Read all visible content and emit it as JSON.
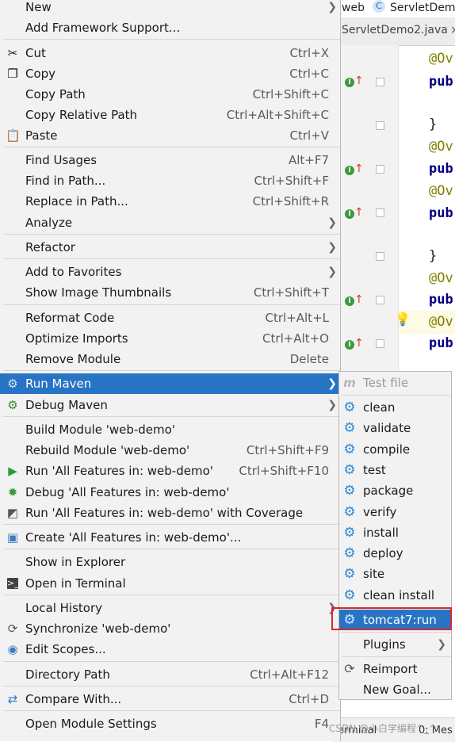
{
  "editor": {
    "tabs": [
      "web",
      "C",
      "ServletDem"
    ],
    "active_file": "ServletDemo2.java",
    "code_lines": [
      {
        "text": "@Ov",
        "kind": "anno"
      },
      {
        "text": "pub",
        "kind": "kw"
      },
      {
        "text": "}",
        "kind": "plain"
      },
      {
        "text": "@Ov",
        "kind": "anno"
      },
      {
        "text": "pub",
        "kind": "kw"
      },
      {
        "text": "@Ov",
        "kind": "anno"
      },
      {
        "text": "pub",
        "kind": "kw"
      },
      {
        "text": "}",
        "kind": "plain"
      },
      {
        "text": "@Ov",
        "kind": "anno"
      },
      {
        "text": "pub",
        "kind": "kw"
      },
      {
        "text": "@Ov",
        "kind": "anno"
      },
      {
        "text": "pub",
        "kind": "kw"
      }
    ],
    "bottom_bar": {
      "terminal": "erminal",
      "messages": "0: Mes"
    }
  },
  "menu": {
    "items": [
      {
        "label": "New",
        "submenu": true
      },
      {
        "label": "Add Framework Support..."
      },
      {
        "label": "Cut",
        "shortcut": "Ctrl+X",
        "icon": "scissors-icon"
      },
      {
        "label": "Copy",
        "shortcut": "Ctrl+C",
        "icon": "copy-icon"
      },
      {
        "label": "Copy Path",
        "shortcut": "Ctrl+Shift+C"
      },
      {
        "label": "Copy Relative Path",
        "shortcut": "Ctrl+Alt+Shift+C"
      },
      {
        "label": "Paste",
        "shortcut": "Ctrl+V",
        "icon": "clipboard-icon"
      },
      {
        "label": "Find Usages",
        "shortcut": "Alt+F7"
      },
      {
        "label": "Find in Path...",
        "shortcut": "Ctrl+Shift+F"
      },
      {
        "label": "Replace in Path...",
        "shortcut": "Ctrl+Shift+R"
      },
      {
        "label": "Analyze",
        "submenu": true
      },
      {
        "label": "Refactor",
        "submenu": true
      },
      {
        "label": "Add to Favorites",
        "submenu": true
      },
      {
        "label": "Show Image Thumbnails",
        "shortcut": "Ctrl+Shift+T"
      },
      {
        "label": "Reformat Code",
        "shortcut": "Ctrl+Alt+L"
      },
      {
        "label": "Optimize Imports",
        "shortcut": "Ctrl+Alt+O"
      },
      {
        "label": "Remove Module",
        "shortcut": "Delete"
      },
      {
        "label": "Run Maven",
        "submenu": true,
        "icon": "maven-gear-icon",
        "selected": true
      },
      {
        "label": "Debug Maven",
        "submenu": true,
        "icon": "maven-debug-gear-icon"
      },
      {
        "label": "Build Module 'web-demo'"
      },
      {
        "label": "Rebuild Module 'web-demo'",
        "shortcut": "Ctrl+Shift+F9"
      },
      {
        "label": "Run 'All Features in: web-demo'",
        "shortcut": "Ctrl+Shift+F10",
        "icon": "run-icon"
      },
      {
        "label": "Debug 'All Features in: web-demo'",
        "icon": "debug-icon"
      },
      {
        "label": "Run 'All Features in: web-demo' with Coverage",
        "icon": "coverage-icon"
      },
      {
        "label": "Create 'All Features in: web-demo'...",
        "icon": "create-config-icon"
      },
      {
        "label": "Show in Explorer"
      },
      {
        "label": "Open in Terminal",
        "icon": "terminal-icon"
      },
      {
        "label": "Local History",
        "submenu": true
      },
      {
        "label": "Synchronize 'web-demo'",
        "icon": "sync-icon"
      },
      {
        "label": "Edit Scopes...",
        "icon": "scope-icon"
      },
      {
        "label": "Directory Path",
        "shortcut": "Ctrl+Alt+F12"
      },
      {
        "label": "Compare With...",
        "shortcut": "Ctrl+D",
        "icon": "compare-icon"
      },
      {
        "label": "Open Module Settings",
        "shortcut": "F4"
      }
    ]
  },
  "submenu": {
    "items": [
      {
        "label": "Test file",
        "icon": "maven-m-icon",
        "disabled": true
      },
      {
        "label": "clean",
        "icon": "gear-icon"
      },
      {
        "label": "validate",
        "icon": "gear-icon"
      },
      {
        "label": "compile",
        "icon": "gear-icon"
      },
      {
        "label": "test",
        "icon": "gear-icon"
      },
      {
        "label": "package",
        "icon": "gear-icon"
      },
      {
        "label": "verify",
        "icon": "gear-icon"
      },
      {
        "label": "install",
        "icon": "gear-icon"
      },
      {
        "label": "deploy",
        "icon": "gear-icon"
      },
      {
        "label": "site",
        "icon": "gear-icon"
      },
      {
        "label": "clean install",
        "icon": "gear-icon"
      },
      {
        "label": "tomcat7:run",
        "icon": "gear-icon",
        "selected": true
      },
      {
        "label": "Plugins",
        "submenu": true
      },
      {
        "label": "Reimport",
        "icon": "refresh-icon"
      },
      {
        "label": "New Goal..."
      }
    ]
  },
  "watermark": "CSDN @小白学编程^_^",
  "colors": {
    "selection": "#2874c4",
    "highlight_box": "#d9262e",
    "menu_bg": "#f2f2f2"
  }
}
